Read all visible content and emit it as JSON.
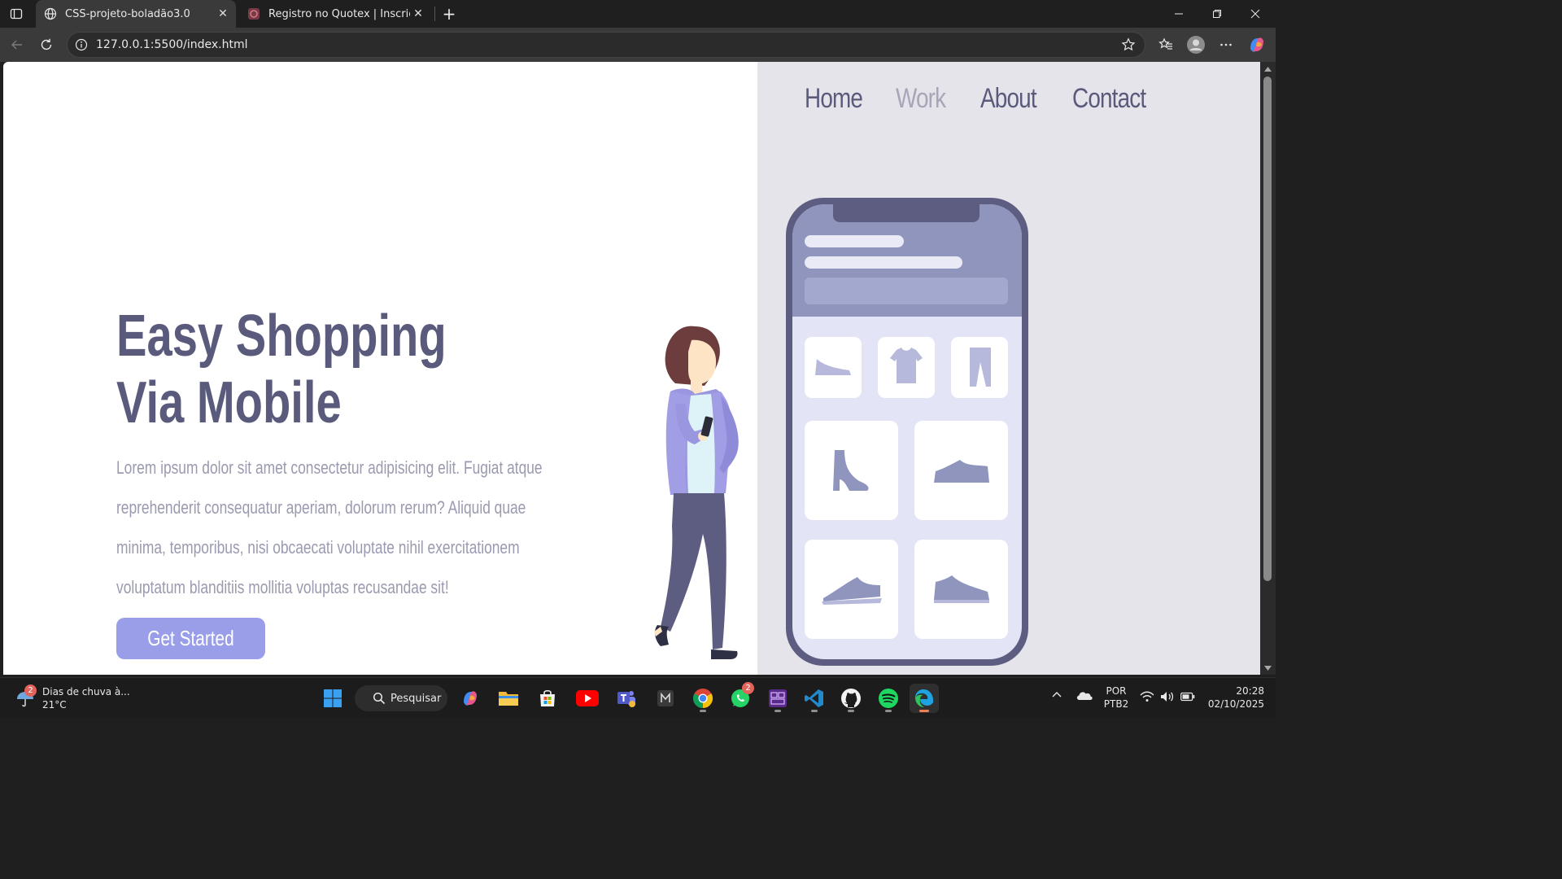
{
  "browser": {
    "tabs": [
      {
        "title": "CSS-projeto-boladão3.0",
        "active": true
      },
      {
        "title": "Registro no Quotex | Inscrição no",
        "active": false
      }
    ],
    "url": "127.0.0.1:5500/index.html"
  },
  "page": {
    "nav": [
      {
        "label": "Home",
        "active": false
      },
      {
        "label": "Work",
        "active": true
      },
      {
        "label": "About",
        "active": false
      },
      {
        "label": "Contact",
        "active": false
      }
    ],
    "hero": {
      "title_line1": "Easy Shopping",
      "title_line2": "Via Mobile",
      "body": "Lorem ipsum dolor sit amet consectetur adipisicing elit. Fugiat atque reprehenderit consequatur aperiam, dolorum rerum? Aliquid quae minima, temporibus, nisi obcaecati voluptate nihil exercitationem voluptatum blanditiis mollitia voluptas recusandae sit!",
      "cta_label": "Get Started"
    },
    "colors": {
      "heading": "#5a5a7c",
      "body_text": "#9a9ab0",
      "cta": "#9a9ee8",
      "panel": "#e5e4ea"
    }
  },
  "taskbar": {
    "weather": {
      "text": "Dias de chuva à...",
      "temp": "21°C",
      "badge": "2"
    },
    "search_label": "Pesquisar",
    "apps": [
      "copilot-icon",
      "file-explorer-icon",
      "store-icon",
      "youtube-icon",
      "teams-icon",
      "m-app-icon",
      "chrome-icon",
      "whatsapp-icon",
      "dev-app-icon",
      "vscode-icon",
      "github-icon",
      "spotify-icon",
      "edge-icon"
    ],
    "whatsapp_badge": "2",
    "language": {
      "line1": "POR",
      "line2": "PTB2"
    },
    "clock": {
      "time": "20:28",
      "date": "02/10/2025"
    }
  }
}
